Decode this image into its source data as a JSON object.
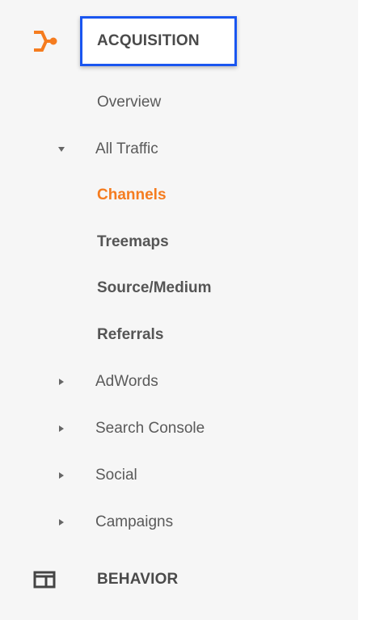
{
  "acquisition": {
    "label": "ACQUISITION",
    "icon": "acquisition-branch-icon",
    "accent": "#f57c1f",
    "highlight_color": "#1a56f0"
  },
  "items": [
    {
      "label": "Overview"
    },
    {
      "label": "All Traffic",
      "expanded": true
    },
    {
      "label": "Channels",
      "selected": true
    },
    {
      "label": "Treemaps"
    },
    {
      "label": "Source/Medium"
    },
    {
      "label": "Referrals"
    },
    {
      "label": "AdWords",
      "expanded": false
    },
    {
      "label": "Search Console",
      "expanded": false
    },
    {
      "label": "Social",
      "expanded": false
    },
    {
      "label": "Campaigns",
      "expanded": false
    }
  ],
  "behavior": {
    "label": "BEHAVIOR",
    "icon": "behavior-window-icon"
  },
  "colors": {
    "active_text": "#f57c1f",
    "text": "#5a5a5a",
    "panel_bg": "#f6f6f6"
  }
}
